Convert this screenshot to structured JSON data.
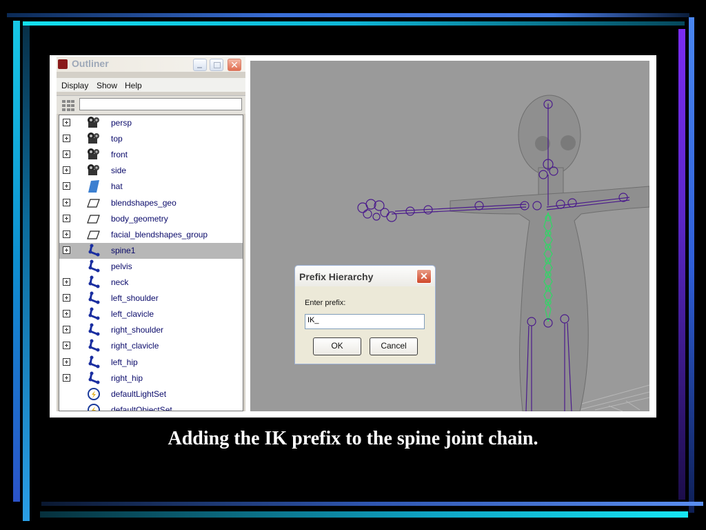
{
  "outliner": {
    "title": "Outliner",
    "menu": [
      "Display",
      "Show",
      "Help"
    ],
    "filter_value": "",
    "items": [
      {
        "label": "persp",
        "icon": "camera-icon",
        "expandable": true,
        "selected": false
      },
      {
        "label": "top",
        "icon": "camera-icon",
        "expandable": true,
        "selected": false
      },
      {
        "label": "front",
        "icon": "camera-icon",
        "expandable": true,
        "selected": false
      },
      {
        "label": "side",
        "icon": "camera-icon",
        "expandable": true,
        "selected": false
      },
      {
        "label": "hat",
        "icon": "mesh-icon",
        "expandable": true,
        "selected": false
      },
      {
        "label": "blendshapes_geo",
        "icon": "transform-icon",
        "expandable": true,
        "selected": false
      },
      {
        "label": "body_geometry",
        "icon": "transform-icon",
        "expandable": true,
        "selected": false
      },
      {
        "label": "facial_blendshapes_group",
        "icon": "transform-icon",
        "expandable": true,
        "selected": false
      },
      {
        "label": "spine1",
        "icon": "joint-icon",
        "expandable": true,
        "selected": true
      },
      {
        "label": "pelvis",
        "icon": "joint-icon",
        "expandable": false,
        "selected": false
      },
      {
        "label": "neck",
        "icon": "joint-icon",
        "expandable": true,
        "selected": false
      },
      {
        "label": "left_shoulder",
        "icon": "joint-icon",
        "expandable": true,
        "selected": false
      },
      {
        "label": "left_clavicle",
        "icon": "joint-icon",
        "expandable": true,
        "selected": false
      },
      {
        "label": "right_shoulder",
        "icon": "joint-icon",
        "expandable": true,
        "selected": false
      },
      {
        "label": "right_clavicle",
        "icon": "joint-icon",
        "expandable": true,
        "selected": false
      },
      {
        "label": "left_hip",
        "icon": "joint-icon",
        "expandable": true,
        "selected": false
      },
      {
        "label": "right_hip",
        "icon": "joint-icon",
        "expandable": true,
        "selected": false
      },
      {
        "label": "defaultLightSet",
        "icon": "set-icon",
        "expandable": false,
        "selected": false
      },
      {
        "label": "defaultObjectSet",
        "icon": "set-icon",
        "expandable": false,
        "selected": false
      }
    ]
  },
  "dialog": {
    "title": "Prefix Hierarchy",
    "label": "Enter prefix:",
    "input_value": "IK_",
    "ok_label": "OK",
    "cancel_label": "Cancel",
    "close_glyph": "✕"
  },
  "caption": "Adding the IK prefix to the spine joint chain.",
  "colors": {
    "selected_row": "#b7b7b7",
    "label_text": "#0a0a6a",
    "joint_purple": "#4a1a8c",
    "spine_green": "#39d06a",
    "viewport_bg": "#9a9a9a"
  }
}
